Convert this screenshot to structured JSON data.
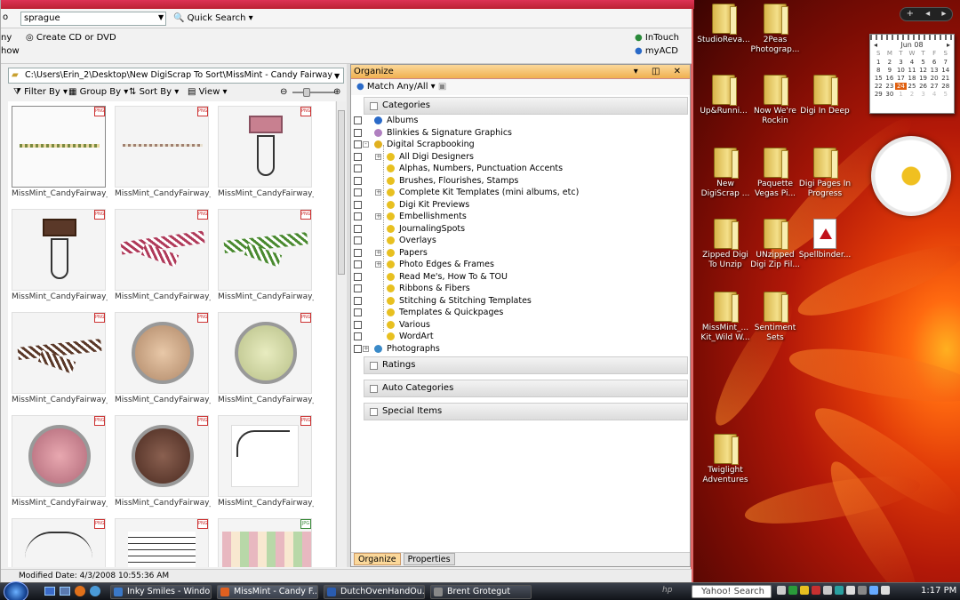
{
  "toolbar": {
    "search_value": "sprague",
    "quick_search": "Quick Search",
    "create_cd": "Create CD or DVD",
    "left_cut_1": "ny",
    "left_cut_2": "how",
    "intouch": "InTouch",
    "myacd": "myACD"
  },
  "path": "C:\\Users\\Erin_2\\Desktop\\New DigiScrap To Sort\\MissMint - Candy Fairway",
  "viewbar": {
    "filter": "Filter By",
    "group": "Group By",
    "sort": "Sort By",
    "view": "View"
  },
  "thumbnails": [
    {
      "label": "MissMint_CandyFairway_...",
      "badge": "PNG"
    },
    {
      "label": "MissMint_CandyFairway_...",
      "badge": "PNG"
    },
    {
      "label": "MissMint_CandyFairway_...",
      "badge": "PNG"
    },
    {
      "label": "MissMint_CandyFairway_...",
      "badge": "PNG"
    },
    {
      "label": "MissMint_CandyFairway_...",
      "badge": "PNG"
    },
    {
      "label": "MissMint_CandyFairway_...",
      "badge": "PNG"
    },
    {
      "label": "MissMint_CandyFairway_...",
      "badge": "PNG"
    },
    {
      "label": "MissMint_CandyFairway_...",
      "badge": "PNG"
    },
    {
      "label": "MissMint_CandyFairway_...",
      "badge": "PNG"
    },
    {
      "label": "MissMint_CandyFairway_...",
      "badge": "PNG"
    },
    {
      "label": "MissMint_CandyFairway_...",
      "badge": "PNG"
    },
    {
      "label": "MissMint_CandyFairway_...",
      "badge": "PNG"
    },
    {
      "label": "",
      "badge": "PNG"
    },
    {
      "label": "",
      "badge": "PNG"
    },
    {
      "label": "",
      "badge": "JPG"
    }
  ],
  "status": "Modified Date: 4/3/2008 10:55:36 AM",
  "organize": {
    "title": "Organize",
    "match": "Match Any/All",
    "categories": "Categories",
    "tree": [
      {
        "label": "Albums",
        "level": 0,
        "expand": false
      },
      {
        "label": "Blinkies & Signature Graphics",
        "level": 0,
        "expand": false
      },
      {
        "label": "Digital Scrapbooking",
        "level": 0,
        "expand": "-"
      },
      {
        "label": "All Digi Designers",
        "level": 1,
        "expand": "+"
      },
      {
        "label": "Alphas, Numbers, Punctuation Accents",
        "level": 1,
        "expand": false
      },
      {
        "label": "Brushes, Flourishes, Stamps",
        "level": 1,
        "expand": false
      },
      {
        "label": "Complete Kit Templates (mini albums, etc)",
        "level": 1,
        "expand": "+"
      },
      {
        "label": "Digi Kit Previews",
        "level": 1,
        "expand": false
      },
      {
        "label": "Embellishments",
        "level": 1,
        "expand": "+"
      },
      {
        "label": "JournalingSpots",
        "level": 1,
        "expand": false
      },
      {
        "label": "Overlays",
        "level": 1,
        "expand": false
      },
      {
        "label": "Papers",
        "level": 1,
        "expand": "+"
      },
      {
        "label": "Photo Edges & Frames",
        "level": 1,
        "expand": "+"
      },
      {
        "label": "Read Me's, How To & TOU",
        "level": 1,
        "expand": false
      },
      {
        "label": "Ribbons & Fibers",
        "level": 1,
        "expand": false
      },
      {
        "label": "Stitching & Stitching Templates",
        "level": 1,
        "expand": false
      },
      {
        "label": "Templates & Quickpages",
        "level": 1,
        "expand": false
      },
      {
        "label": "Various",
        "level": 1,
        "expand": false
      },
      {
        "label": "WordArt",
        "level": 1,
        "expand": false
      },
      {
        "label": "Photographs",
        "level": 0,
        "expand": "+"
      }
    ],
    "ratings": "Ratings",
    "auto_categories": "Auto Categories",
    "special_items": "Special Items",
    "tab_organize": "Organize",
    "tab_properties": "Properties"
  },
  "desktop": {
    "icons": [
      {
        "label": "StudioReva...",
        "type": "folder"
      },
      {
        "label": "2Peas Photograp...",
        "type": "folder"
      },
      {
        "label": "Up&Runni...",
        "type": "folder"
      },
      {
        "label": "Now We're Rockin",
        "type": "folder"
      },
      {
        "label": "Digi In Deep",
        "type": "folder"
      },
      {
        "label": "New DigiScrap ...",
        "type": "folder"
      },
      {
        "label": "Paquette Vegas Pi...",
        "type": "folder"
      },
      {
        "label": "Digi Pages In Progress",
        "type": "folder"
      },
      {
        "label": "Zipped Digi To Unzip",
        "type": "folder"
      },
      {
        "label": "UNzipped Digi Zip Fil...",
        "type": "folder"
      },
      {
        "label": "Spellbinder...",
        "type": "pdf"
      },
      {
        "label": "MissMint_... Kit_Wild W...",
        "type": "folder"
      },
      {
        "label": "Sentiment Sets",
        "type": "folder"
      },
      {
        "label": "Twiglight Adventures",
        "type": "folder"
      }
    ],
    "calendar": {
      "month": "Jun 08",
      "days": [
        "S",
        "M",
        "T",
        "W",
        "T",
        "F",
        "S"
      ],
      "dates": [
        "",
        "",
        "",
        "",
        "",
        "",
        "",
        "1",
        "2",
        "3",
        "4",
        "5",
        "6",
        "7",
        "8",
        "9",
        "10",
        "11",
        "12",
        "13",
        "14",
        "15",
        "16",
        "17",
        "18",
        "19",
        "20",
        "21",
        "22",
        "23",
        "24",
        "25",
        "26",
        "27",
        "28",
        "29",
        "30",
        "1",
        "2",
        "3",
        "4",
        "5"
      ],
      "today": "24"
    }
  },
  "taskbar": {
    "tasks": [
      {
        "label": "Inky Smiles - Windo...",
        "color": "#3a78c8"
      },
      {
        "label": "MissMint - Candy F...",
        "color": "#e06020"
      },
      {
        "label": "DutchOvenHandOu...",
        "color": "#2a5cb0"
      },
      {
        "label": "Brent Grotegut",
        "color": "#888888"
      }
    ],
    "search": "Yahoo! Search",
    "time": "1:17 PM"
  }
}
